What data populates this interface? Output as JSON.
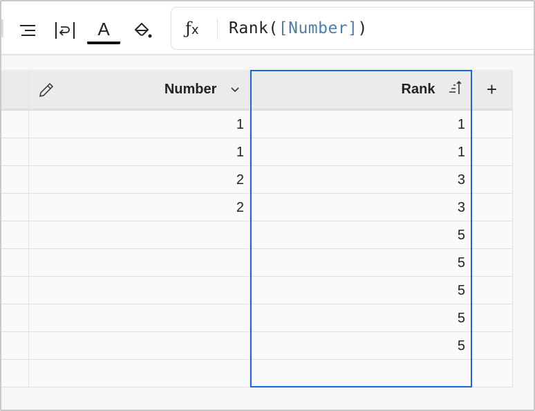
{
  "toolbar": {
    "buttons": [
      "align-right",
      "wrap-text",
      "text-color",
      "fill-color"
    ],
    "text_color": "#000000"
  },
  "formula_bar": {
    "fx_label": "fx",
    "function": "Rank(",
    "reference": "[Number]",
    "close": ")"
  },
  "table": {
    "columns": [
      {
        "name": "Number",
        "icon": "chevron-down-icon"
      },
      {
        "name": "Rank",
        "icon": "sort-ascending-icon"
      }
    ],
    "add_column": "+",
    "rows": [
      [
        "1",
        "1"
      ],
      [
        "1",
        "1"
      ],
      [
        "2",
        "3"
      ],
      [
        "2",
        "3"
      ],
      [
        "",
        "5"
      ],
      [
        "",
        "5"
      ],
      [
        "",
        "5"
      ],
      [
        "",
        "5"
      ],
      [
        "",
        "5"
      ],
      [
        "",
        ""
      ]
    ]
  },
  "colors": {
    "selection": "#1a66e0",
    "reference": "#4f7cac"
  }
}
